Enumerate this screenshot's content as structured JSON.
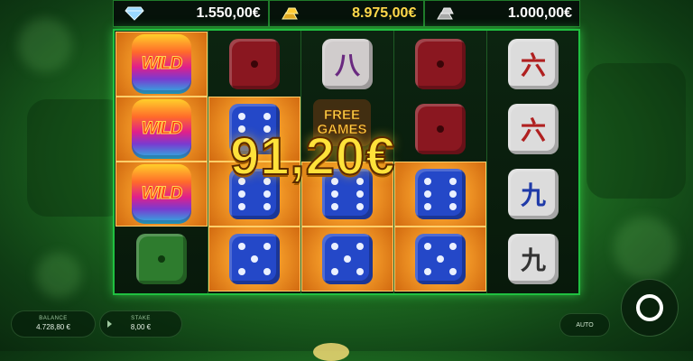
{
  "jackpots": [
    {
      "icon": "diamond-icon",
      "value": "1.550,00€",
      "color": "#ffffff"
    },
    {
      "icon": "gold-bars-icon",
      "value": "8.975,00€",
      "color": "#ffd84a"
    },
    {
      "icon": "silver-bars-icon",
      "value": "1.000,00€",
      "color": "#ffffff"
    }
  ],
  "reels": {
    "wild_label": "WILD",
    "free_games_label_1": "FREE",
    "free_games_label_2": "GAMES",
    "glyph_eight": "八",
    "glyph_six": "六",
    "glyph_nine": "九"
  },
  "win_amount": "91,20€",
  "footer": {
    "balance_label": "BALANCE",
    "balance_value": "4.728,80 €",
    "stake_label": "STAKE",
    "stake_value": "8,00 €",
    "auto_label": "AUTO"
  },
  "colors": {
    "reel_border": "#20c040",
    "win_text": "#ffe23a"
  }
}
